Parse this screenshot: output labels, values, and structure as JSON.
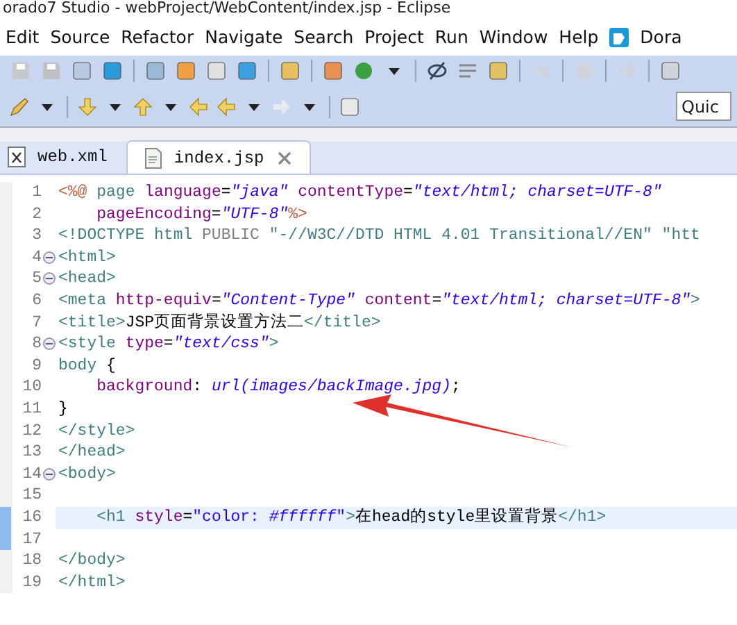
{
  "window": {
    "title": "orado7 Studio - webProject/WebContent/index.jsp - Eclipse"
  },
  "menu": [
    "Edit",
    "Source",
    "Refactor",
    "Navigate",
    "Search",
    "Project",
    "Run",
    "Window",
    "Help"
  ],
  "plugin_menu": "Dora",
  "quick_access": {
    "placeholder": "Quic"
  },
  "tabs": [
    {
      "label": "web.xml",
      "kind": "xml",
      "selected": false
    },
    {
      "label": "index.jsp",
      "kind": "jsp",
      "selected": true
    }
  ],
  "editor": {
    "lines": [
      {
        "number": "1",
        "foldable": false,
        "current": false,
        "changed": false,
        "tokens": [
          {
            "kind": "jsp",
            "text": "<%@"
          },
          {
            "kind": "tag",
            "text": " page "
          },
          {
            "kind": "attr",
            "text": "language"
          },
          {
            "kind": "text",
            "text": "="
          },
          {
            "kind": "string",
            "text": "\"java\""
          },
          {
            "kind": "attr",
            "text": " contentType"
          },
          {
            "kind": "text",
            "text": "="
          },
          {
            "kind": "string",
            "text": "\"text/html; charset=UTF-8\""
          }
        ]
      },
      {
        "number": "2",
        "foldable": false,
        "current": false,
        "changed": false,
        "tokens": [
          {
            "kind": "attr",
            "text": "    pageEncoding"
          },
          {
            "kind": "text",
            "text": "="
          },
          {
            "kind": "string",
            "text": "\"UTF-8\""
          },
          {
            "kind": "jsp",
            "text": "%>"
          }
        ]
      },
      {
        "number": "3",
        "foldable": false,
        "current": false,
        "changed": false,
        "tokens": [
          {
            "kind": "tag",
            "text": "<!DOCTYPE html "
          },
          {
            "kind": "doctype",
            "text": "PUBLIC "
          },
          {
            "kind": "tag",
            "text": "\"-//W3C//DTD HTML 4.01 Transitional//EN\" \"htt"
          }
        ]
      },
      {
        "number": "4",
        "foldable": true,
        "current": false,
        "changed": false,
        "tokens": [
          {
            "kind": "tag",
            "text": "<html>"
          }
        ]
      },
      {
        "number": "5",
        "foldable": true,
        "current": false,
        "changed": false,
        "tokens": [
          {
            "kind": "tag",
            "text": "<head>"
          }
        ]
      },
      {
        "number": "6",
        "foldable": false,
        "current": false,
        "changed": false,
        "tokens": [
          {
            "kind": "tag",
            "text": "<meta "
          },
          {
            "kind": "attr",
            "text": "http-equiv"
          },
          {
            "kind": "text",
            "text": "="
          },
          {
            "kind": "string",
            "text": "\"Content-Type\""
          },
          {
            "kind": "attr",
            "text": " content"
          },
          {
            "kind": "text",
            "text": "="
          },
          {
            "kind": "string",
            "text": "\"text/html; charset=UTF-8\""
          },
          {
            "kind": "tag",
            "text": ">"
          }
        ]
      },
      {
        "number": "7",
        "foldable": false,
        "current": false,
        "changed": false,
        "tokens": [
          {
            "kind": "tag",
            "text": "<title>"
          },
          {
            "kind": "text",
            "text": "JSP页面背景设置方法二"
          },
          {
            "kind": "tag",
            "text": "</title>"
          }
        ]
      },
      {
        "number": "8",
        "foldable": true,
        "current": false,
        "changed": false,
        "tokens": [
          {
            "kind": "tag",
            "text": "<style "
          },
          {
            "kind": "attr",
            "text": "type"
          },
          {
            "kind": "text",
            "text": "="
          },
          {
            "kind": "string",
            "text": "\"text/css\""
          },
          {
            "kind": "tag",
            "text": ">"
          }
        ]
      },
      {
        "number": "9",
        "foldable": false,
        "current": false,
        "changed": false,
        "tokens": [
          {
            "kind": "selector",
            "text": "body"
          },
          {
            "kind": "text",
            "text": " {"
          }
        ]
      },
      {
        "number": "10",
        "foldable": false,
        "current": false,
        "changed": false,
        "tokens": [
          {
            "kind": "attr",
            "text": "    background"
          },
          {
            "kind": "text",
            "text": ": "
          },
          {
            "kind": "string",
            "text": "url(images/backImage.jpg)"
          },
          {
            "kind": "text",
            "text": ";"
          }
        ]
      },
      {
        "number": "11",
        "foldable": false,
        "current": false,
        "changed": false,
        "tokens": [
          {
            "kind": "text",
            "text": "}"
          }
        ]
      },
      {
        "number": "12",
        "foldable": false,
        "current": false,
        "changed": false,
        "tokens": [
          {
            "kind": "tag",
            "text": "</style>"
          }
        ]
      },
      {
        "number": "13",
        "foldable": false,
        "current": false,
        "changed": false,
        "tokens": [
          {
            "kind": "tag",
            "text": "</head>"
          }
        ]
      },
      {
        "number": "14",
        "foldable": true,
        "current": false,
        "changed": false,
        "tokens": [
          {
            "kind": "tag",
            "text": "<body>"
          }
        ]
      },
      {
        "number": "15",
        "foldable": false,
        "current": false,
        "changed": false
      },
      {
        "number": "16",
        "foldable": false,
        "current": true,
        "changed": true,
        "tokens": [
          {
            "kind": "tag",
            "text": "    <h1 "
          },
          {
            "kind": "attr",
            "text": "style"
          },
          {
            "kind": "text",
            "text": "="
          },
          {
            "kind": "plainstring",
            "text": "\"color: "
          },
          {
            "kind": "string",
            "text": "#ffffff"
          },
          {
            "kind": "plainstring",
            "text": "\""
          },
          {
            "kind": "tag",
            "text": ">"
          },
          {
            "kind": "text",
            "text": "在head的style里设置背景"
          },
          {
            "kind": "tag",
            "text": "</h1>"
          }
        ]
      },
      {
        "number": "17",
        "foldable": false,
        "current": false,
        "changed": true
      },
      {
        "number": "18",
        "foldable": false,
        "current": false,
        "changed": false,
        "tokens": [
          {
            "kind": "tag",
            "text": "</body>"
          }
        ]
      },
      {
        "number": "19",
        "foldable": false,
        "current": false,
        "changed": false,
        "tokens": [
          {
            "kind": "tag",
            "text": "</html>"
          }
        ]
      }
    ]
  }
}
